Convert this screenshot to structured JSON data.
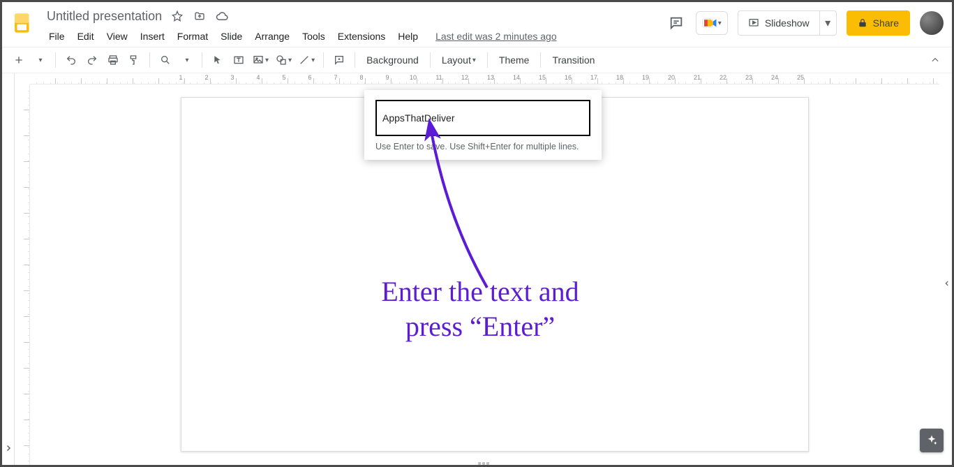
{
  "doc": {
    "title": "Untitled presentation",
    "last_edit": "Last edit was 2 minutes ago"
  },
  "menus": [
    "File",
    "Edit",
    "View",
    "Insert",
    "Format",
    "Slide",
    "Arrange",
    "Tools",
    "Extensions",
    "Help"
  ],
  "header_actions": {
    "slideshow": "Slideshow",
    "share": "Share"
  },
  "toolbar": {
    "groups_text": {
      "background": "Background",
      "layout": "Layout",
      "theme": "Theme",
      "transition": "Transition"
    }
  },
  "ruler_numbers": [
    1,
    2,
    3,
    4,
    5,
    6,
    7,
    8,
    9,
    10,
    11,
    12,
    13,
    14,
    15,
    16,
    17,
    18,
    19,
    20,
    21,
    22,
    23,
    24,
    25
  ],
  "popup": {
    "value": "AppsThatDeliver",
    "hint": "Use Enter to save. Use Shift+Enter for multiple lines."
  },
  "annotation": {
    "line1": "Enter the text and",
    "line2": "press “Enter”"
  }
}
